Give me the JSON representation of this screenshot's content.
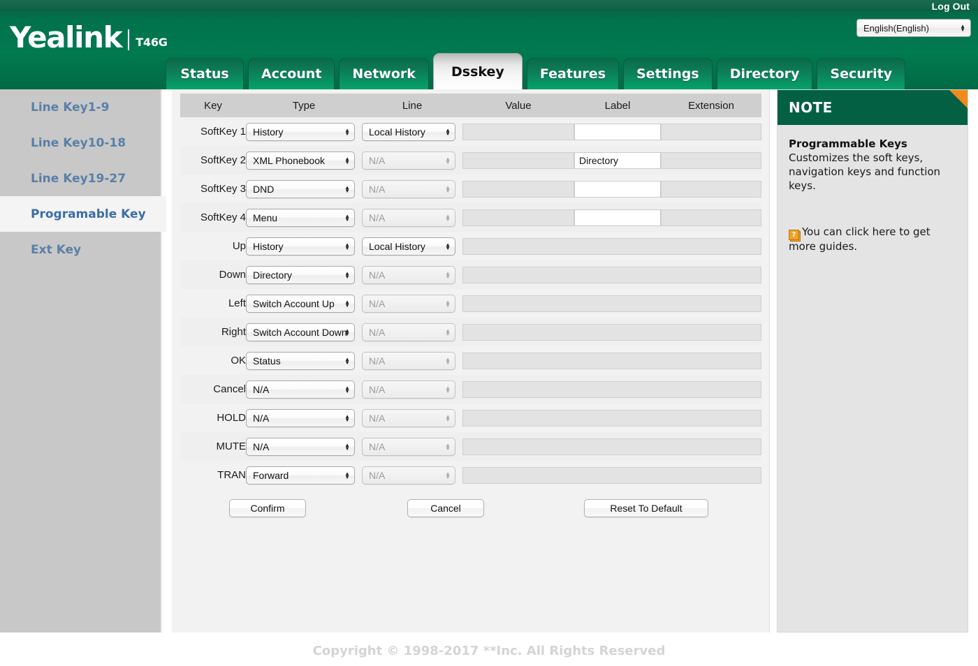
{
  "header": {
    "logout_label": "Log Out",
    "language_value": "English(English)",
    "brand": "Yealink",
    "model": "T46G",
    "tabs": [
      {
        "label": "Status",
        "active": false
      },
      {
        "label": "Account",
        "active": false
      },
      {
        "label": "Network",
        "active": false
      },
      {
        "label": "Dsskey",
        "active": true
      },
      {
        "label": "Features",
        "active": false
      },
      {
        "label": "Settings",
        "active": false
      },
      {
        "label": "Directory",
        "active": false
      },
      {
        "label": "Security",
        "active": false
      }
    ]
  },
  "sidebar": {
    "items": [
      {
        "label": "Line Key1-9",
        "active": false
      },
      {
        "label": "Line Key10-18",
        "active": false
      },
      {
        "label": "Line Key19-27",
        "active": false
      },
      {
        "label": "Programable Key",
        "active": true
      },
      {
        "label": "Ext Key",
        "active": false
      }
    ]
  },
  "table": {
    "columns": [
      "Key",
      "Type",
      "Line",
      "Value",
      "Label",
      "Extension"
    ],
    "rows": [
      {
        "key": "SoftKey 1",
        "type": "History",
        "type_disabled": false,
        "line": "Local History",
        "line_disabled": false,
        "value": "",
        "label": "",
        "extension": "",
        "merged": false,
        "label_editable": true
      },
      {
        "key": "SoftKey 2",
        "type": "XML Phonebook",
        "type_disabled": false,
        "line": "N/A",
        "line_disabled": true,
        "value": "",
        "label": "Directory",
        "extension": "",
        "merged": false,
        "label_editable": true
      },
      {
        "key": "SoftKey 3",
        "type": "DND",
        "type_disabled": false,
        "line": "N/A",
        "line_disabled": true,
        "value": "",
        "label": "",
        "extension": "",
        "merged": false,
        "label_editable": true
      },
      {
        "key": "SoftKey 4",
        "type": "Menu",
        "type_disabled": false,
        "line": "N/A",
        "line_disabled": true,
        "value": "",
        "label": "",
        "extension": "",
        "merged": false,
        "label_editable": true
      },
      {
        "key": "Up",
        "type": "History",
        "type_disabled": false,
        "line": "Local History",
        "line_disabled": false,
        "value": "",
        "label": "",
        "extension": "",
        "merged": true,
        "label_editable": false
      },
      {
        "key": "Down",
        "type": "Directory",
        "type_disabled": false,
        "line": "N/A",
        "line_disabled": true,
        "value": "",
        "label": "",
        "extension": "",
        "merged": true,
        "label_editable": false
      },
      {
        "key": "Left",
        "type": "Switch Account Up",
        "type_disabled": false,
        "line": "N/A",
        "line_disabled": true,
        "value": "",
        "label": "",
        "extension": "",
        "merged": true,
        "label_editable": false
      },
      {
        "key": "Right",
        "type": "Switch Account Down",
        "type_disabled": false,
        "line": "N/A",
        "line_disabled": true,
        "value": "",
        "label": "",
        "extension": "",
        "merged": true,
        "label_editable": false
      },
      {
        "key": "OK",
        "type": "Status",
        "type_disabled": false,
        "line": "N/A",
        "line_disabled": true,
        "value": "",
        "label": "",
        "extension": "",
        "merged": true,
        "label_editable": false
      },
      {
        "key": "Cancel",
        "type": "N/A",
        "type_disabled": false,
        "line": "N/A",
        "line_disabled": true,
        "value": "",
        "label": "",
        "extension": "",
        "merged": true,
        "label_editable": false
      },
      {
        "key": "HOLD",
        "type": "N/A",
        "type_disabled": false,
        "line": "N/A",
        "line_disabled": true,
        "value": "",
        "label": "",
        "extension": "",
        "merged": true,
        "label_editable": false
      },
      {
        "key": "MUTE",
        "type": "N/A",
        "type_disabled": false,
        "line": "N/A",
        "line_disabled": true,
        "value": "",
        "label": "",
        "extension": "",
        "merged": true,
        "label_editable": false
      },
      {
        "key": "TRAN",
        "type": "Forward",
        "type_disabled": false,
        "line": "N/A",
        "line_disabled": true,
        "value": "",
        "label": "",
        "extension": "",
        "merged": true,
        "label_editable": false
      }
    ]
  },
  "buttons": {
    "confirm": "Confirm",
    "cancel": "Cancel",
    "reset": "Reset To Default"
  },
  "note": {
    "header": "NOTE",
    "title": "Programmable Keys",
    "text": "Customizes the soft keys, navigation keys and function keys.",
    "guide": "You can click here to get more guides.",
    "help_icon": "?"
  },
  "footer": {
    "copyright": "Copyright © 1998-2017 **Inc. All Rights Reserved"
  },
  "colors": {
    "brand_green": "#01724c",
    "note_green": "#046043",
    "accent_orange": "#f08a1c",
    "sidebar_gray": "#c8c8c8",
    "link_blue": "#5a7fa8"
  }
}
